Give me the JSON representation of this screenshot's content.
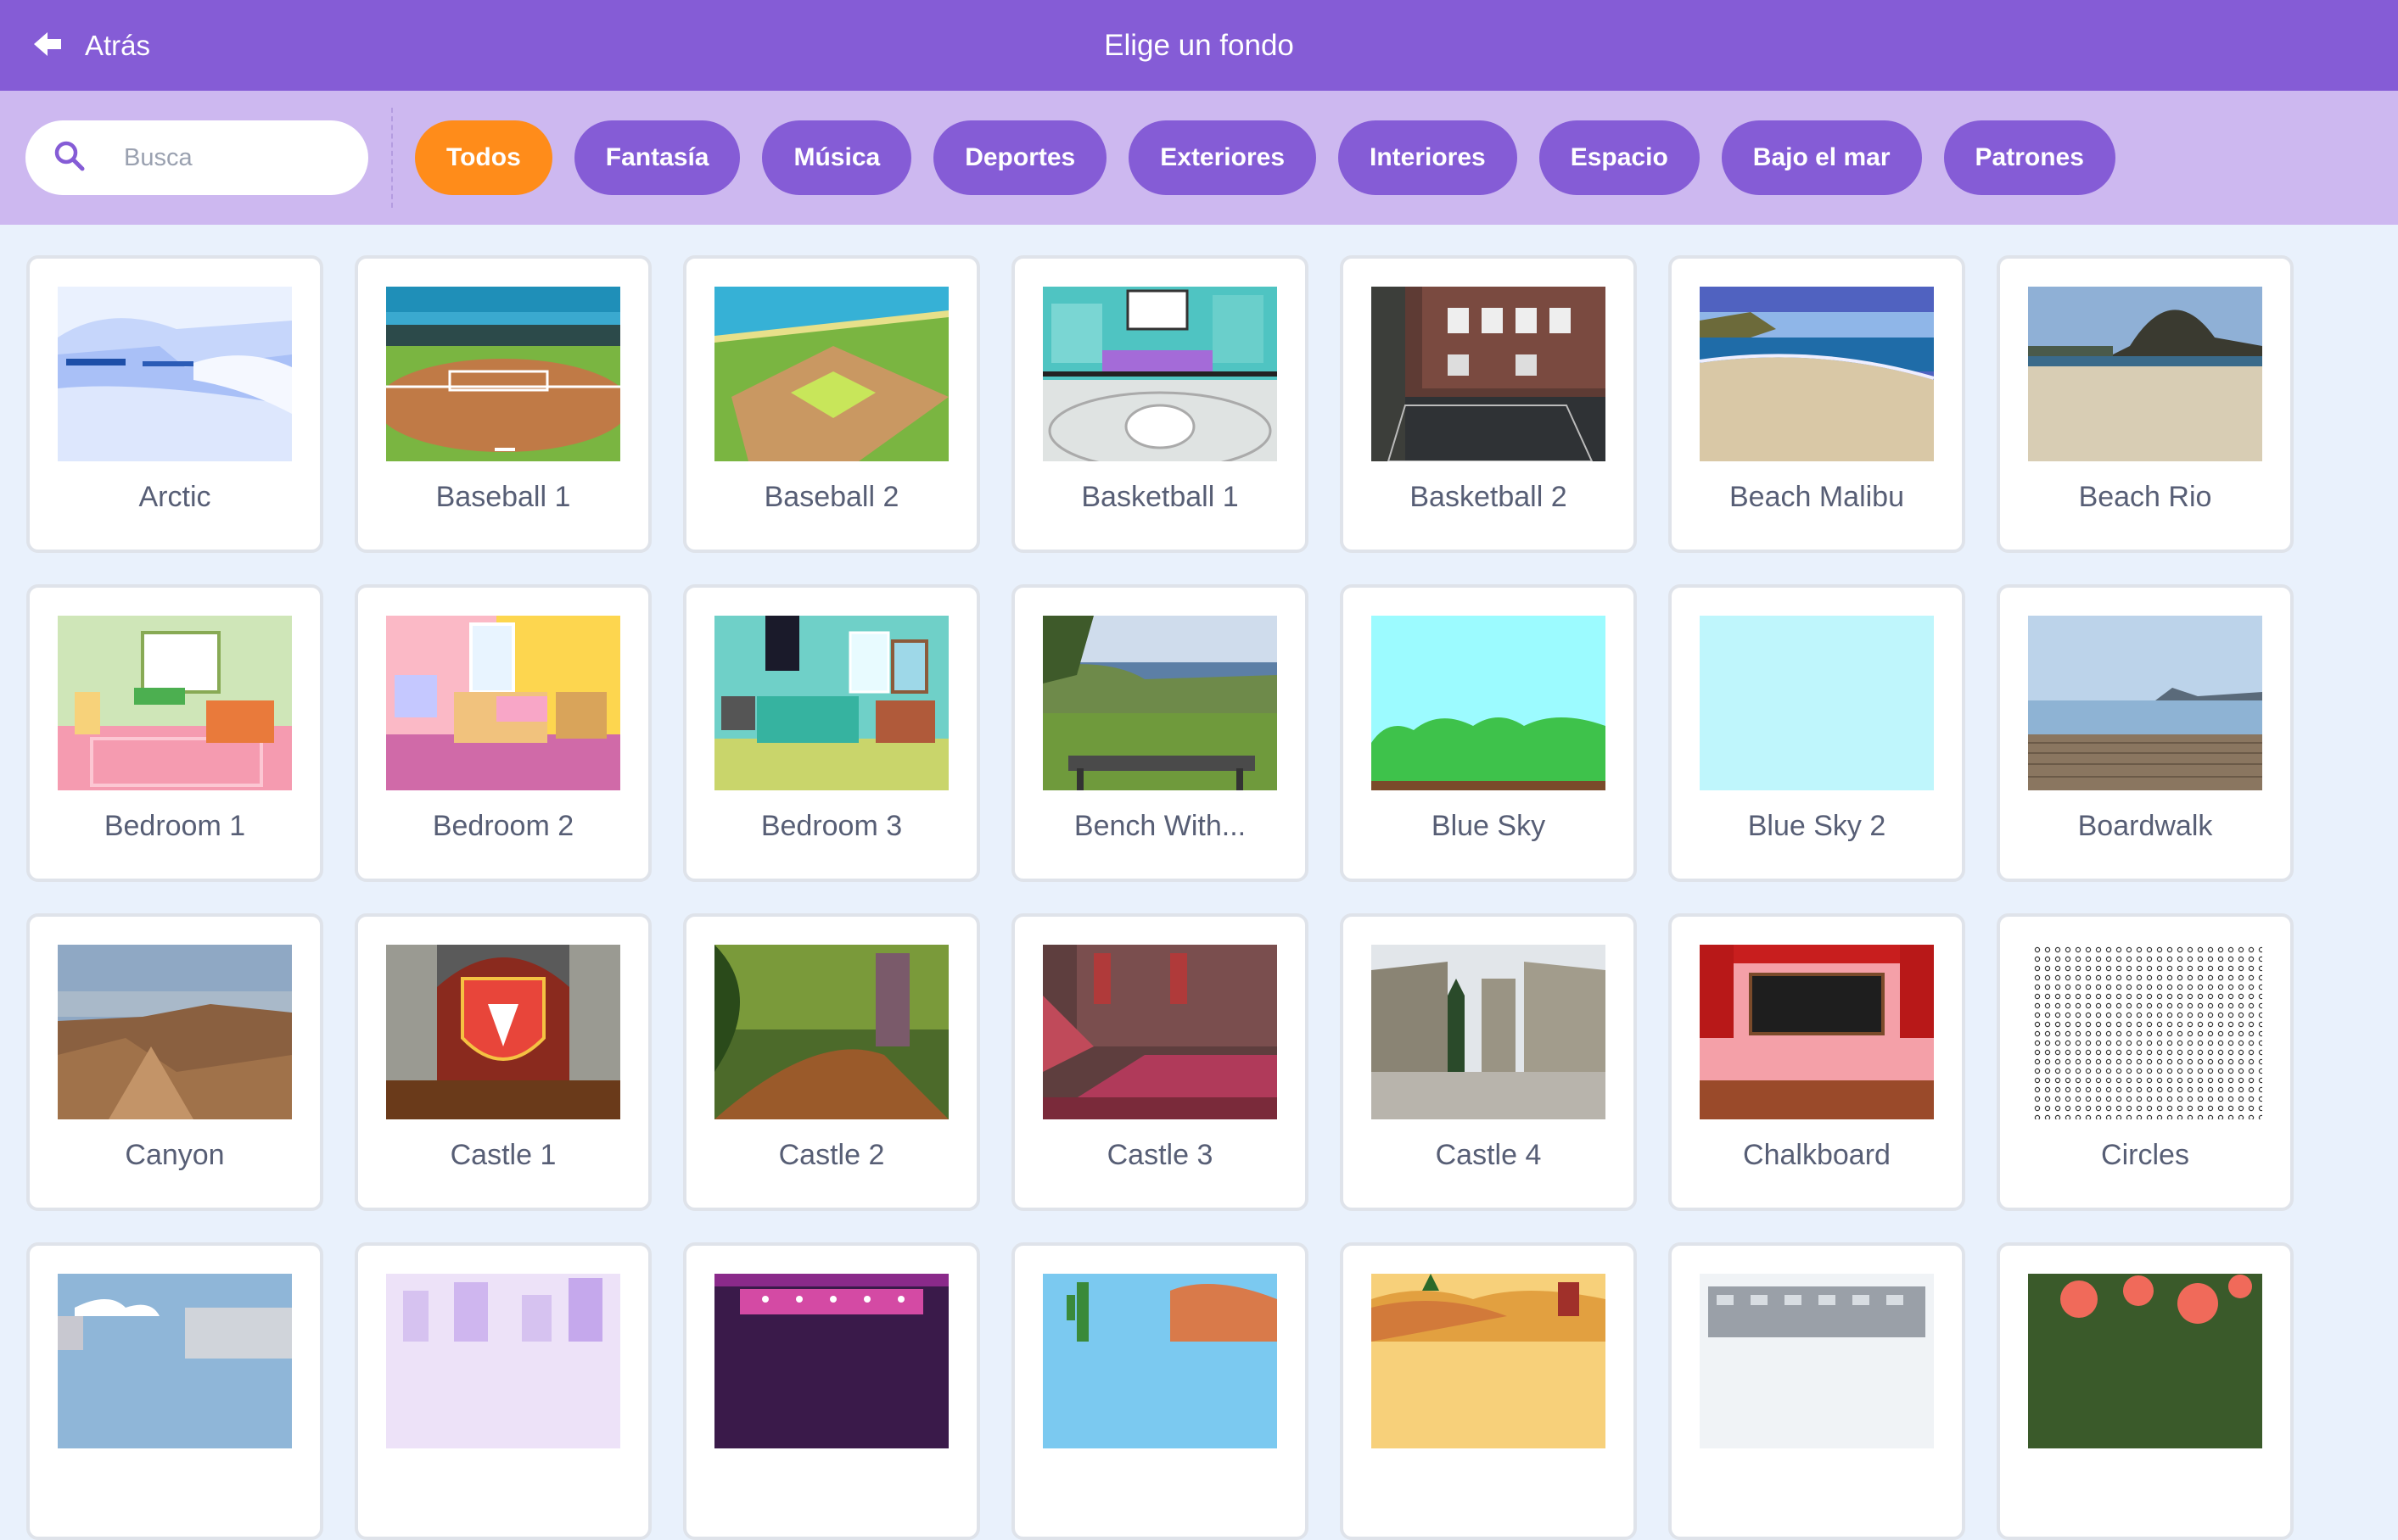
{
  "header": {
    "back_label": "Atrás",
    "title": "Elige un fondo"
  },
  "search": {
    "placeholder": "Busca",
    "value": ""
  },
  "categories": [
    {
      "label": "Todos",
      "active": true
    },
    {
      "label": "Fantasía",
      "active": false
    },
    {
      "label": "Música",
      "active": false
    },
    {
      "label": "Deportes",
      "active": false
    },
    {
      "label": "Exteriores",
      "active": false
    },
    {
      "label": "Interiores",
      "active": false
    },
    {
      "label": "Espacio",
      "active": false
    },
    {
      "label": "Bajo el mar",
      "active": false
    },
    {
      "label": "Patrones",
      "active": false
    }
  ],
  "colors": {
    "header": "#855cd6",
    "filter_bar": "#cdb8f0",
    "active_chip": "#ff8c1a",
    "chip": "#855cd6",
    "background": "#e9f1fc",
    "label_text": "#575e75"
  },
  "backdrops": [
    {
      "name": "Arctic",
      "thumb": "arctic"
    },
    {
      "name": "Baseball 1",
      "thumb": "baseball1"
    },
    {
      "name": "Baseball 2",
      "thumb": "baseball2"
    },
    {
      "name": "Basketball 1",
      "thumb": "basketball1"
    },
    {
      "name": "Basketball 2",
      "thumb": "basketball2"
    },
    {
      "name": "Beach Malibu",
      "thumb": "beach-malibu"
    },
    {
      "name": "Beach Rio",
      "thumb": "beach-rio"
    },
    {
      "name": "Bedroom 1",
      "thumb": "bedroom1"
    },
    {
      "name": "Bedroom 2",
      "thumb": "bedroom2"
    },
    {
      "name": "Bedroom 3",
      "thumb": "bedroom3"
    },
    {
      "name": "Bench With...",
      "thumb": "bench"
    },
    {
      "name": "Blue Sky",
      "thumb": "blue-sky"
    },
    {
      "name": "Blue Sky 2",
      "thumb": "blue-sky-2"
    },
    {
      "name": "Boardwalk",
      "thumb": "boardwalk"
    },
    {
      "name": "Canyon",
      "thumb": "canyon"
    },
    {
      "name": "Castle 1",
      "thumb": "castle1"
    },
    {
      "name": "Castle 2",
      "thumb": "castle2"
    },
    {
      "name": "Castle 3",
      "thumb": "castle3"
    },
    {
      "name": "Castle 4",
      "thumb": "castle4"
    },
    {
      "name": "Chalkboard",
      "thumb": "chalkboard"
    },
    {
      "name": "Circles",
      "thumb": "circles"
    },
    {
      "name": "",
      "thumb": "city"
    },
    {
      "name": "",
      "thumb": "city-purple"
    },
    {
      "name": "",
      "thumb": "concert"
    },
    {
      "name": "",
      "thumb": "desert"
    },
    {
      "name": "",
      "thumb": "farm"
    },
    {
      "name": "",
      "thumb": "building"
    },
    {
      "name": "",
      "thumb": "flowers"
    }
  ]
}
